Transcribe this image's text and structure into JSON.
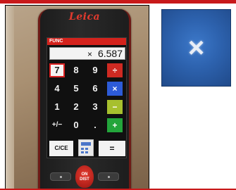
{
  "device": {
    "brand": "Leica",
    "screen": {
      "mode": "FUNC",
      "display": {
        "operator": "×",
        "value": "6.587"
      },
      "keys": [
        [
          "7",
          "8",
          "9",
          "÷"
        ],
        [
          "4",
          "5",
          "6",
          "×"
        ],
        [
          "1",
          "2",
          "3",
          "−"
        ],
        [
          "+/−",
          "0",
          ".",
          "+"
        ]
      ],
      "bottom": {
        "clear": "C/CE",
        "equals": "="
      }
    },
    "pad": {
      "on_label": "ON",
      "dist_label": "DIST"
    }
  },
  "inset": {
    "symbol": "×"
  },
  "colors": {
    "accent": "#c8191a",
    "divide": "#cf2a22",
    "multiply": "#2d5bd7",
    "subtract": "#a7c02e",
    "add": "#23a53b"
  }
}
